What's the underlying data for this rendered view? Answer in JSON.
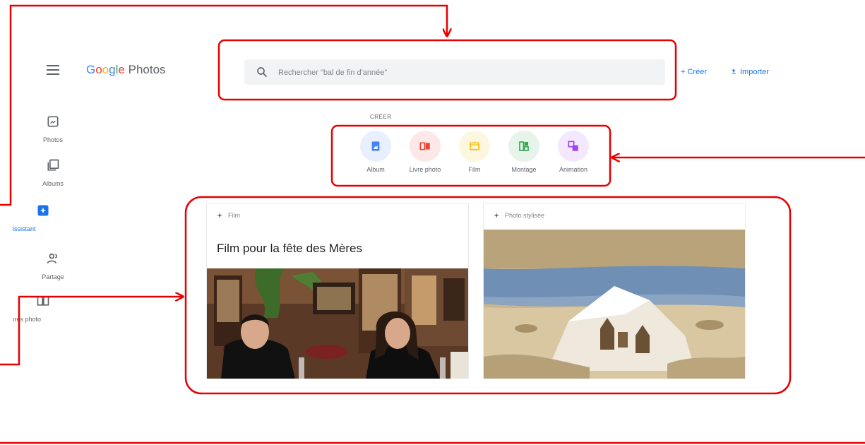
{
  "header": {
    "logo_text": [
      "G",
      "o",
      "o",
      "g",
      "l",
      "e"
    ],
    "logo_suffix": "Photos",
    "search_placeholder": "Rechercher \"bal de fin d'année\"",
    "create_label": "+ Créer",
    "import_label": "Importer"
  },
  "sidebar": {
    "items": [
      {
        "label": "Photos",
        "icon": "photo-icon"
      },
      {
        "label": "Albums",
        "icon": "albums-icon"
      },
      {
        "label": "issistant",
        "icon": "assistant-icon",
        "active": true
      },
      {
        "label": "Partage",
        "icon": "sharing-icon"
      },
      {
        "label": "ıres photo",
        "icon": "photo-books-icon"
      }
    ]
  },
  "create": {
    "heading": "CRÉER",
    "items": [
      {
        "label": "Album",
        "icon": "album-icon",
        "bg": "#e8f0fe",
        "fg": "#4285f4"
      },
      {
        "label": "Livre photo",
        "icon": "photo-book-icon",
        "bg": "#fce8e6",
        "fg": "#ea4335"
      },
      {
        "label": "Film",
        "icon": "film-icon",
        "bg": "#fef7e0",
        "fg": "#fbbc05"
      },
      {
        "label": "Montage",
        "icon": "collage-icon",
        "bg": "#e6f4ea",
        "fg": "#34a853"
      },
      {
        "label": "Animation",
        "icon": "animation-icon",
        "bg": "#f3e8fd",
        "fg": "#a142f4"
      }
    ]
  },
  "cards": [
    {
      "kind": "Film",
      "title": "Film pour la fête des Mères"
    },
    {
      "kind": "Photo stylisée"
    }
  ],
  "colors": {
    "accent": "#1a73e8",
    "annotation": "#e60000"
  }
}
